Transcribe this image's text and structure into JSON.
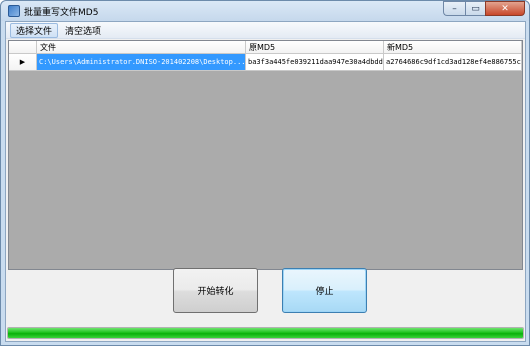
{
  "window": {
    "title": "批量重写文件MD5",
    "min_glyph": "–",
    "max_glyph": "▭",
    "close_glyph": "✕"
  },
  "menu": {
    "items": [
      {
        "label": "选择文件",
        "active": true
      },
      {
        "label": "清空选项",
        "active": false
      }
    ]
  },
  "grid": {
    "columns": [
      {
        "label": ""
      },
      {
        "label": "文件"
      },
      {
        "label": "原MD5"
      },
      {
        "label": "新MD5"
      }
    ],
    "rows": [
      {
        "indicator": "▶",
        "file": "C:\\Users\\Administrator.DNISO-201402208\\Desktop...",
        "old_md5": "ba3f3a445fe039211daa947e30a4dbdd",
        "new_md5": "a2764686c9df1cd3ad128ef4e886755c"
      }
    ]
  },
  "buttons": {
    "start_label": "开始转化",
    "stop_label": "停止"
  },
  "progress": {
    "value": 1.0,
    "color": "#1fc41f"
  }
}
